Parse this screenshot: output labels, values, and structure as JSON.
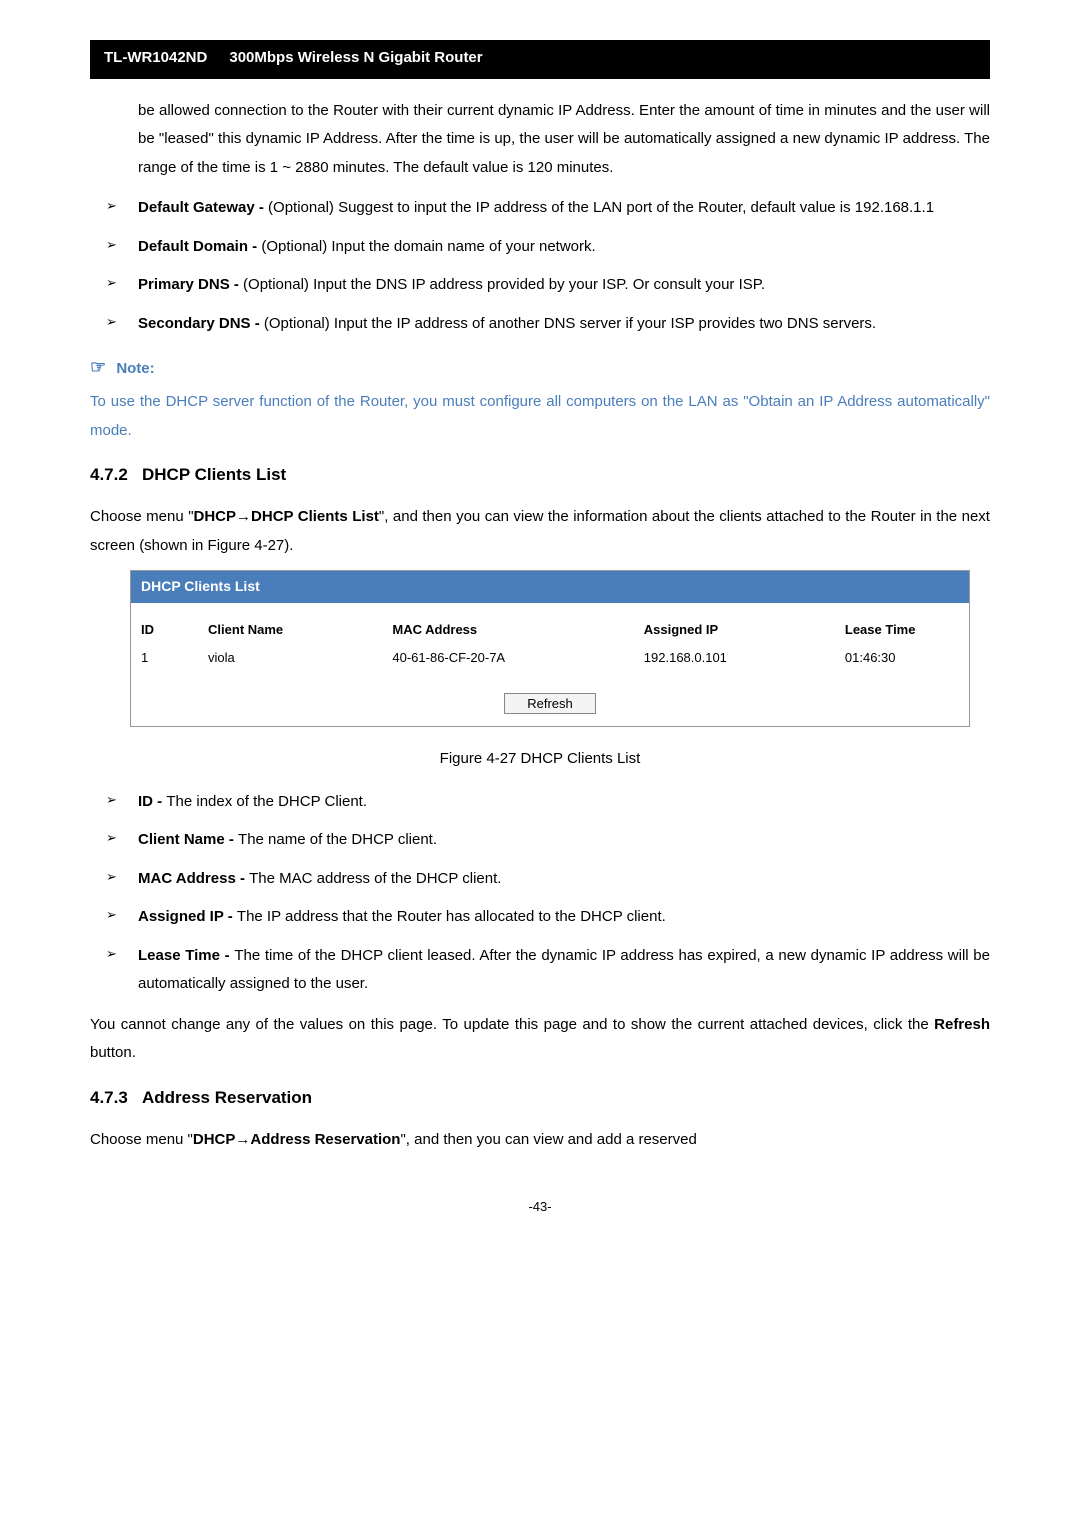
{
  "header": {
    "model": "TL-WR1042ND",
    "desc": "300Mbps Wireless N Gigabit Router"
  },
  "intro_para": "be allowed connection to the Router with their current dynamic IP Address. Enter the amount of time in minutes and the user will be \"leased\" this dynamic IP Address. After the time is up, the user will be automatically assigned a new dynamic IP address. The range of the time is 1 ~ 2880 minutes. The default value is 120 minutes.",
  "top_bullets": [
    {
      "bold": "Default Gateway - ",
      "rest": "(Optional) Suggest to input the IP address of the LAN port of the Router, default value is 192.168.1.1"
    },
    {
      "bold": "Default Domain - ",
      "rest": "(Optional) Input the domain name of your network."
    },
    {
      "bold": "Primary DNS - ",
      "rest": "(Optional) Input the DNS IP address provided by your ISP. Or consult your ISP."
    },
    {
      "bold": "Secondary DNS - ",
      "rest": "(Optional) Input the IP address of another DNS server if your ISP provides two DNS servers."
    }
  ],
  "note": {
    "label": "Note:",
    "text": "To use the DHCP server function of the Router, you must configure all computers on the LAN as \"Obtain an IP Address automatically\" mode."
  },
  "section472": {
    "num": "4.7.2",
    "title": "DHCP Clients List",
    "para_pre": "Choose menu \"",
    "para_bold1": "DHCP",
    "arrow": "→",
    "para_bold2": "DHCP Clients List",
    "para_post": "\", and then you can view the information about the clients attached to the Router in the next screen (shown in Figure 4-27)."
  },
  "dhcp_widget": {
    "title": "DHCP Clients List",
    "cols": {
      "id": "ID",
      "name": "Client Name",
      "mac": "MAC Address",
      "ip": "Assigned IP",
      "lease": "Lease Time"
    },
    "rows": [
      {
        "id": "1",
        "name": "viola",
        "mac": "40-61-86-CF-20-7A",
        "ip": "192.168.0.101",
        "lease": "01:46:30"
      }
    ],
    "refresh": "Refresh"
  },
  "fig_caption": "Figure 4-27   DHCP Clients List",
  "clients_bullets": [
    {
      "bold": "ID - ",
      "rest": "The index of the DHCP Client."
    },
    {
      "bold": "Client Name - ",
      "rest": "The name of the DHCP client."
    },
    {
      "bold": "MAC Address - ",
      "rest": "The MAC address of the DHCP client."
    },
    {
      "bold": "Assigned IP - ",
      "rest": "The IP address that the Router has allocated to the DHCP client."
    },
    {
      "bold": "Lease Time - ",
      "rest": "The time of the DHCP client leased. After the dynamic IP address has expired, a new dynamic IP address will be automatically assigned to the user."
    }
  ],
  "refresh_para_pre": "You cannot change any of the values on this page. To update this page and to show the current attached devices, click the ",
  "refresh_para_bold": "Refresh",
  "refresh_para_post": " button.",
  "section473": {
    "num": "4.7.3",
    "title": "Address Reservation",
    "para_pre": "Choose menu \"",
    "para_bold1": "DHCP",
    "arrow": "→",
    "para_bold2": "Address Reservation",
    "para_post": "\", and then you can view and add a reserved"
  },
  "page_num": "-43-"
}
